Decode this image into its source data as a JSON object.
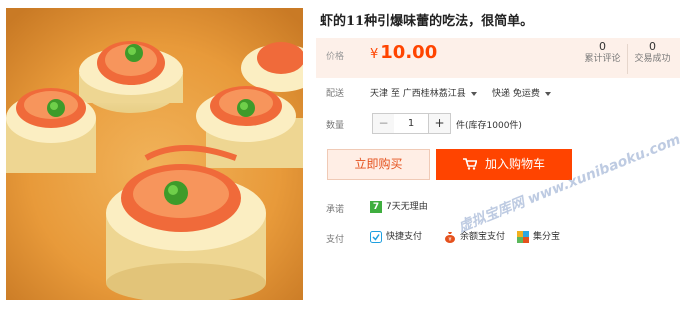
{
  "product": {
    "title": "虾的11种引爆味蕾的吃法，很简单。"
  },
  "price": {
    "label": "价格",
    "currency": "¥",
    "amount": "10.00",
    "color": "#ff4400"
  },
  "stats": {
    "reviews_count": "0",
    "reviews_label": "累计评论",
    "sales_count": "0",
    "sales_label": "交易成功"
  },
  "shipping": {
    "label": "配送",
    "route": "天津 至 广西桂林荔江县",
    "method": "快递 免运费"
  },
  "quantity": {
    "label": "数量",
    "minus": "−",
    "value": "1",
    "plus": "+",
    "unit_stock": "件(库存1000件)"
  },
  "buttons": {
    "buy_now": "立即购买",
    "add_to_cart": "加入购物车"
  },
  "promise": {
    "label": "承诺",
    "badge": "7",
    "text": "7天无理由"
  },
  "payment": {
    "label": "支付",
    "methods": [
      "快捷支付",
      "余额宝支付",
      "集分宝"
    ]
  },
  "watermark": {
    "text": "虚拟宝库网 www.xunibaoku.com"
  },
  "colors": {
    "accent": "#ff4400",
    "price_bg": "#fdf0e9",
    "buy_now_bg": "#ffeee5"
  }
}
